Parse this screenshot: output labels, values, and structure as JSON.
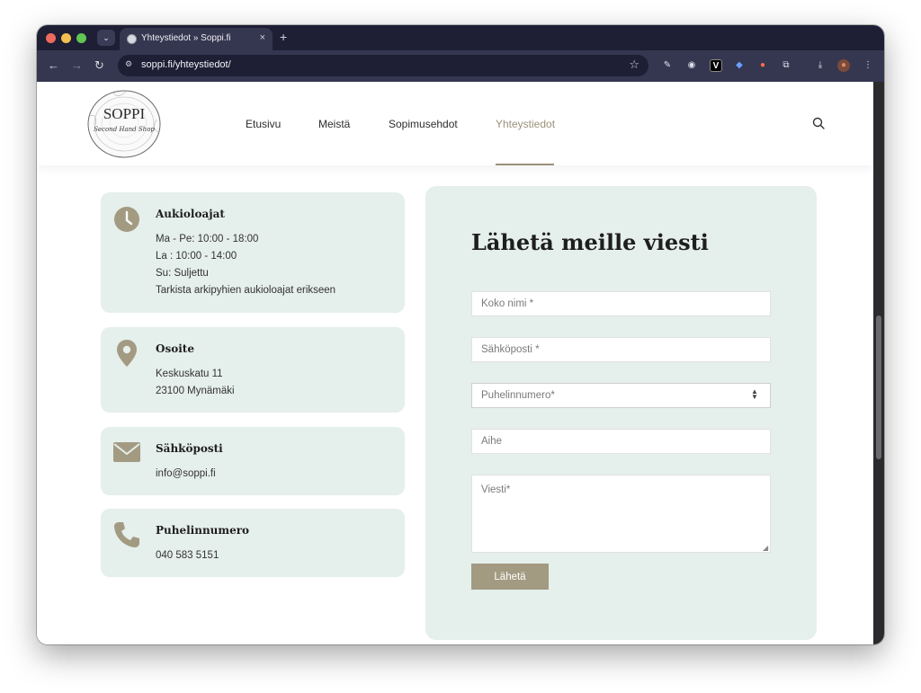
{
  "browser": {
    "tab_title": "Yhteystiedot » Soppi.fi",
    "tab_close": "×",
    "new_tab": "+",
    "tab_search": "⌄",
    "url": "soppi.fi/yhteystiedot/",
    "back": "←",
    "forward": "→",
    "reload": "↻",
    "site_info": "⚙",
    "star": "☆",
    "extensions": [
      "✎",
      "◉",
      "V",
      "◆",
      "●",
      "⧉",
      "⤓",
      "●",
      "⋮"
    ]
  },
  "header": {
    "logo_text": "SOPPI",
    "logo_subtext": "Second Hand Shop",
    "nav": [
      {
        "label": "Etusivu"
      },
      {
        "label": "Meistä"
      },
      {
        "label": "Sopimusehdot"
      },
      {
        "label": "Yhteystiedot",
        "active": true
      }
    ]
  },
  "cards": [
    {
      "title": "Aukioloajat",
      "icon": "clock-icon",
      "lines": [
        "Ma - Pe: 10:00 - 18:00",
        "La : 10:00 - 14:00",
        "Su: Suljettu",
        "Tarkista arkipyhien aukioloajat erikseen"
      ]
    },
    {
      "title": "Osoite",
      "icon": "location-pin-icon",
      "lines": [
        "Keskuskatu 11",
        "23100 Mynämäki"
      ]
    },
    {
      "title": "Sähköposti",
      "icon": "envelope-icon",
      "lines": [
        "info@soppi.fi"
      ]
    },
    {
      "title": "Puhelinnumero",
      "icon": "phone-icon",
      "lines": [
        "040 583 5151"
      ]
    }
  ],
  "form": {
    "title": "Lähetä meille viesti",
    "name_placeholder": "Koko nimi *",
    "email_placeholder": "Sähköposti *",
    "phone_placeholder": "Puhelinnumero*",
    "subject_placeholder": "Aihe",
    "message_placeholder": "Viesti*",
    "submit_label": "Lähetä"
  },
  "colors": {
    "accent": "#a39a82",
    "card_bg": "#e5efeb",
    "browser_dark": "#1e1f35"
  }
}
